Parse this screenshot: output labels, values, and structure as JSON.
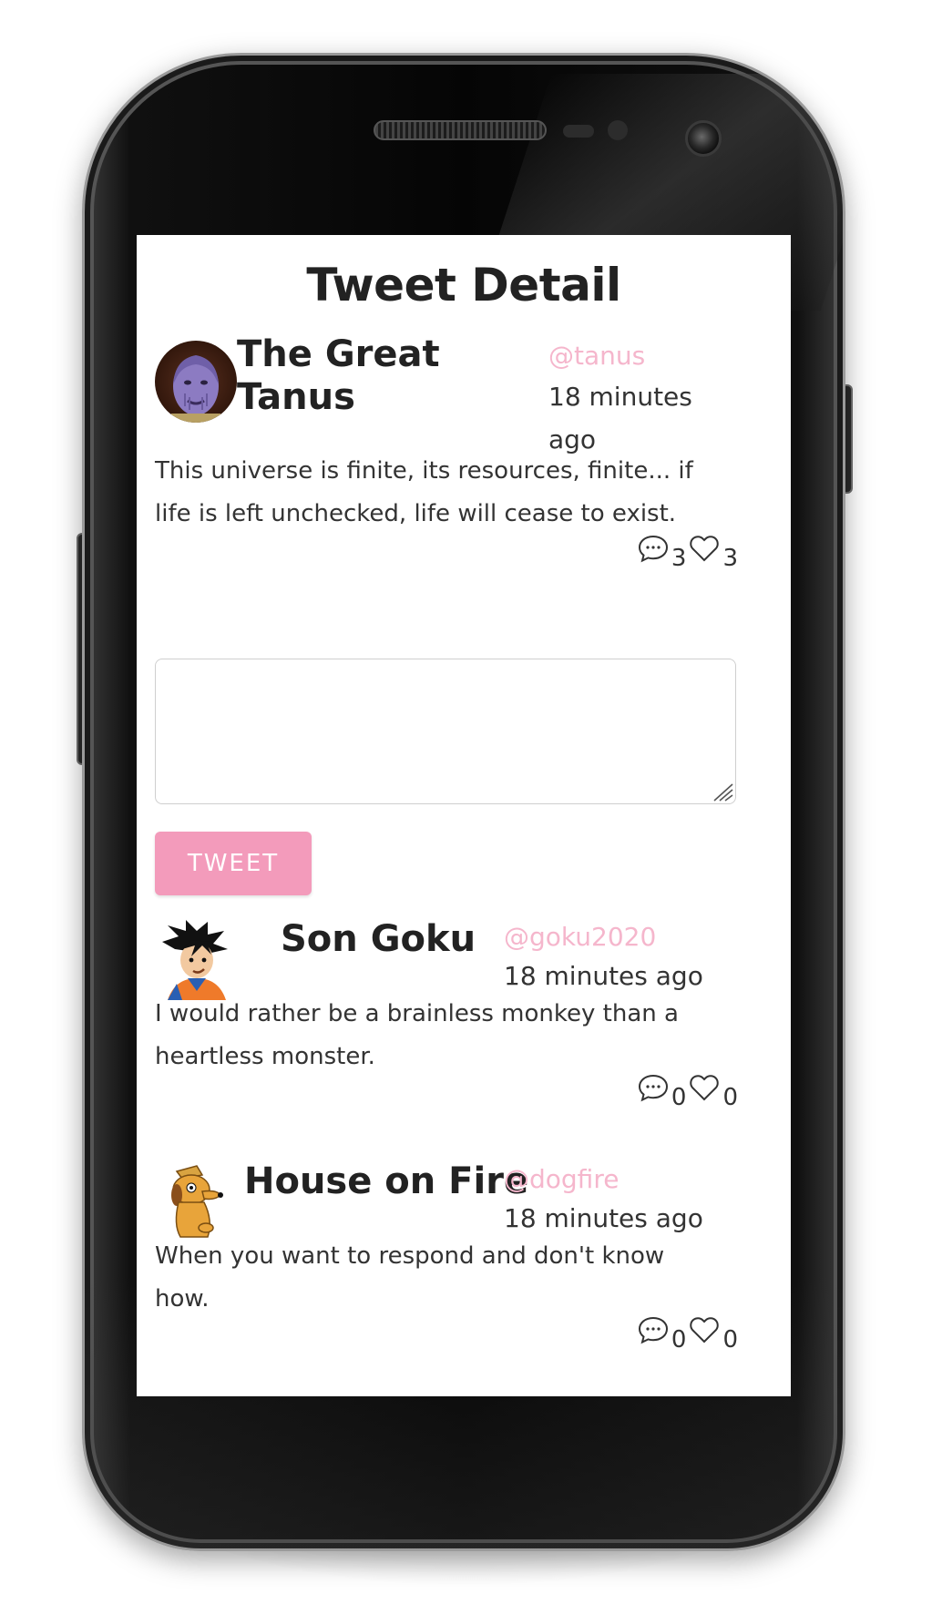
{
  "page": {
    "title": "Tweet Detail"
  },
  "main_tweet": {
    "name_line1": "The Great",
    "name_line2": "Tanus",
    "handle": "@tanus",
    "time_line1": "18 minutes",
    "time_line2": "ago",
    "text_line1": "This universe is finite, its resources, finite... if",
    "text_line2": "life is left unchecked, life will cease to exist.",
    "replies": "3",
    "likes": "3",
    "avatar_icon": "thanos-avatar"
  },
  "compose": {
    "value": "",
    "placeholder": "",
    "button_label": "TWEET"
  },
  "replies": [
    {
      "name": "Son Goku",
      "handle": "@goku2020",
      "time": "18 minutes ago",
      "text_line1": "I would rather be a brainless monkey than a",
      "text_line2": "heartless monster.",
      "replies": "0",
      "likes": "0",
      "avatar_icon": "goku-avatar"
    },
    {
      "name": "House on Fire",
      "handle": "@dogfire",
      "time": "18 minutes ago",
      "text_line1": "When you want to respond and don't know",
      "text_line2": "how.",
      "replies": "0",
      "likes": "0",
      "avatar_icon": "dog-avatar"
    }
  ],
  "colors": {
    "accent": "#f39bbb",
    "handle": "#f5b6cc",
    "text": "#222222"
  }
}
